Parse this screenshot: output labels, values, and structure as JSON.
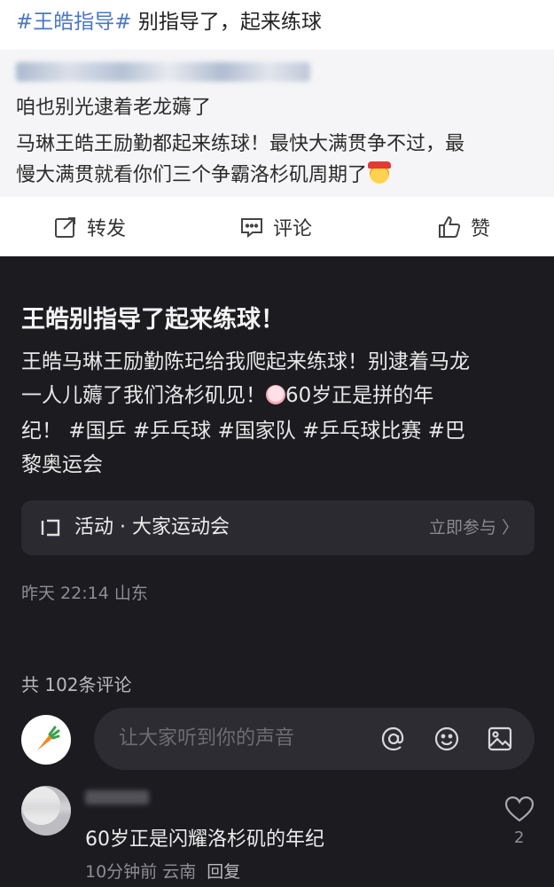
{
  "top": {
    "headline_tag": "#王皓指导#",
    "headline_text": " 别指导了，起来练球",
    "quote": {
      "line1": "咱也别光逮着老龙薅了",
      "line2": "马琳王皓王励勤都起来练球！最快大满贯争不过，最",
      "line3": "慢大满贯就看你们三个争霸洛杉矶周期了",
      "emoji": "cheer-face-emoji"
    },
    "actions": {
      "share_label": "转发",
      "comment_label": "评论",
      "like_label": "赞"
    }
  },
  "post": {
    "title": "王皓别指导了起来练球！",
    "body_line1": "王皓马琳王励勤陈玘给我爬起来练球！别逮着马龙",
    "body_line2a": "一人儿薅了我们洛杉矶见！",
    "body_line2b": "60岁正是拼的年",
    "body_line3": "纪！ #国乒 #乒乓球 #国家队 #乒乓球比赛 #巴",
    "body_line4": "黎奥运会",
    "activity_label": "活动 · 大家运动会",
    "activity_join": "立即参与 〉",
    "meta": "昨天 22:14 山东"
  },
  "comments": {
    "count_label": "共 102条评论",
    "composer_placeholder": "让大家听到你的声音",
    "items": [
      {
        "text": "60岁正是闪耀洛杉矶的年纪",
        "time": "10分钟前",
        "location": "云南",
        "reply_label": "回复",
        "likes": "2"
      }
    ]
  },
  "colors": {
    "hashtag_blue": "#4a78c2",
    "dark_bg": "#1b1b20",
    "light_bg": "#ffffff"
  }
}
